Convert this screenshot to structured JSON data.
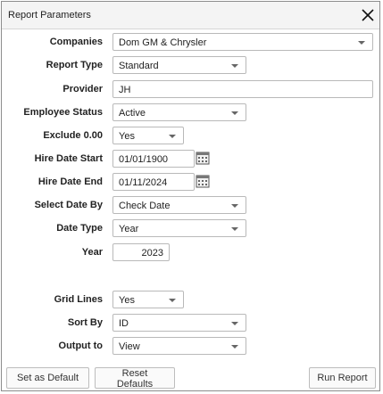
{
  "dialog": {
    "title": "Report Parameters",
    "close_icon": "close-icon"
  },
  "fields": {
    "companies": {
      "label": "Companies",
      "value": "Dom GM & Chrysler"
    },
    "report_type": {
      "label": "Report Type",
      "value": "Standard"
    },
    "provider": {
      "label": "Provider",
      "value": "JH"
    },
    "employee_status": {
      "label": "Employee Status",
      "value": "Active"
    },
    "exclude_zero": {
      "label": "Exclude 0.00",
      "value": "Yes"
    },
    "hire_date_start": {
      "label": "Hire Date Start",
      "value": "01/01/1900",
      "icon": "calendar-icon"
    },
    "hire_date_end": {
      "label": "Hire Date End",
      "value": "01/11/2024",
      "icon": "calendar-icon"
    },
    "select_date_by": {
      "label": "Select Date By",
      "value": "Check Date"
    },
    "date_type": {
      "label": "Date Type",
      "value": "Year"
    },
    "year": {
      "label": "Year",
      "value": "2023"
    },
    "grid_lines": {
      "label": "Grid Lines",
      "value": "Yes"
    },
    "sort_by": {
      "label": "Sort By",
      "value": "ID"
    },
    "output_to": {
      "label": "Output to",
      "value": "View"
    }
  },
  "buttons": {
    "set_default": "Set as Default",
    "reset_defaults": "Reset Defaults",
    "run_report": "Run Report"
  }
}
